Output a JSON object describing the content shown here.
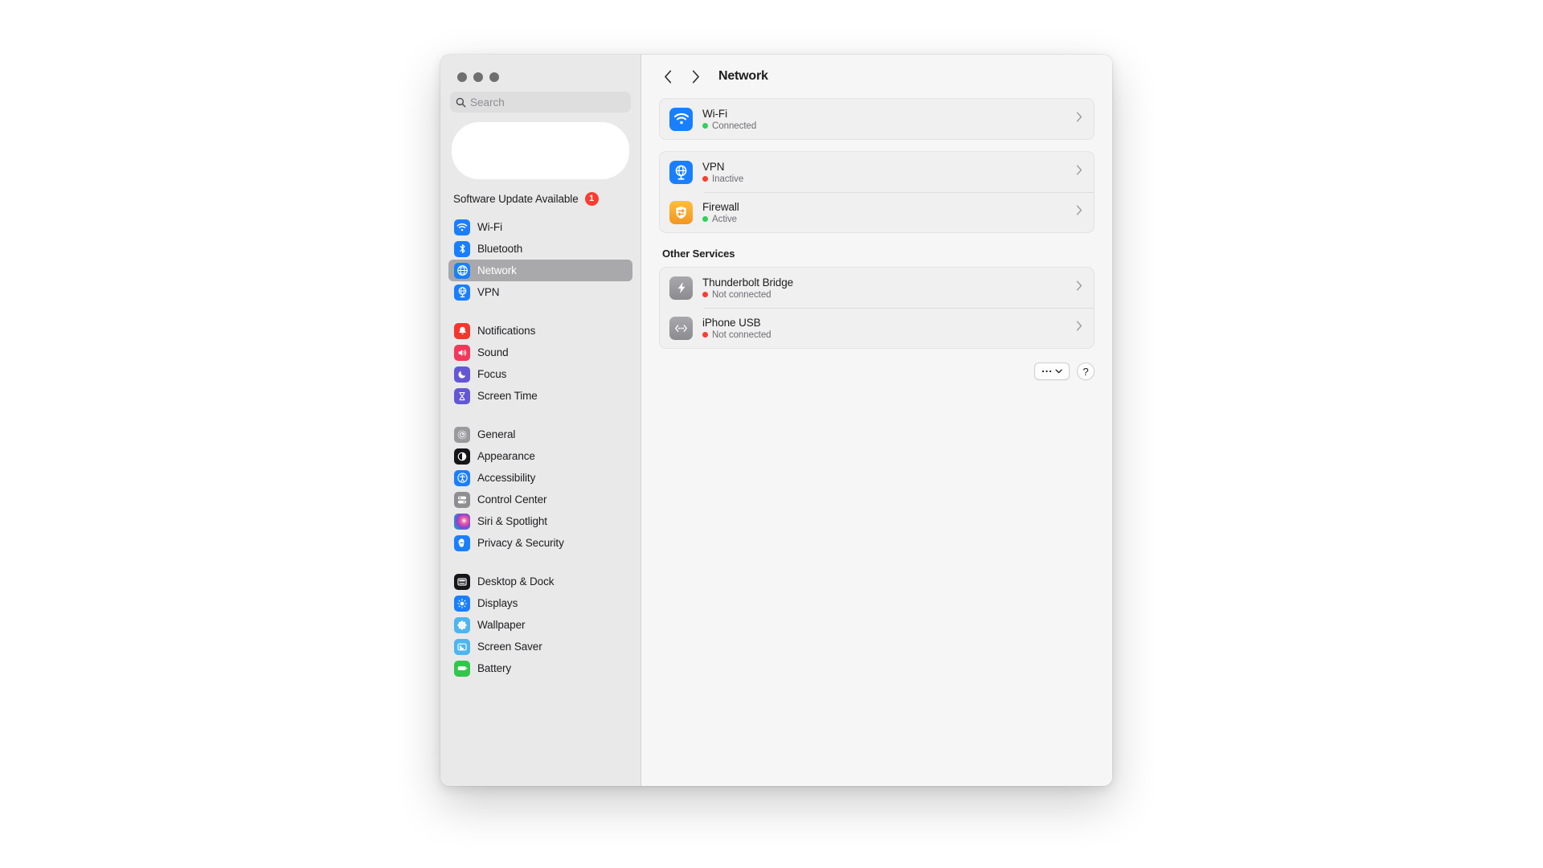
{
  "window": {
    "traffic_lights": [
      "close",
      "minimize",
      "zoom"
    ]
  },
  "sidebar": {
    "search": {
      "placeholder": "Search",
      "value": ""
    },
    "update": {
      "label": "Software Update Available",
      "badge": "1"
    },
    "groups": [
      {
        "items": [
          {
            "label": "Wi-Fi",
            "icon": "wifi-icon",
            "selected": false
          },
          {
            "label": "Bluetooth",
            "icon": "bluetooth-icon",
            "selected": false
          },
          {
            "label": "Network",
            "icon": "network-globe-icon",
            "selected": true
          },
          {
            "label": "VPN",
            "icon": "vpn-globe-icon",
            "selected": false
          }
        ]
      },
      {
        "items": [
          {
            "label": "Notifications",
            "icon": "bell-icon",
            "selected": false
          },
          {
            "label": "Sound",
            "icon": "speaker-icon",
            "selected": false
          },
          {
            "label": "Focus",
            "icon": "moon-icon",
            "selected": false
          },
          {
            "label": "Screen Time",
            "icon": "hourglass-icon",
            "selected": false
          }
        ]
      },
      {
        "items": [
          {
            "label": "General",
            "icon": "gear-icon",
            "selected": false
          },
          {
            "label": "Appearance",
            "icon": "appearance-contrast-icon",
            "selected": false
          },
          {
            "label": "Accessibility",
            "icon": "accessibility-person-icon",
            "selected": false
          },
          {
            "label": "Control Center",
            "icon": "control-center-toggles-icon",
            "selected": false
          },
          {
            "label": "Siri & Spotlight",
            "icon": "siri-orb-icon",
            "selected": false
          },
          {
            "label": "Privacy & Security",
            "icon": "privacy-hand-icon",
            "selected": false
          }
        ]
      },
      {
        "items": [
          {
            "label": "Desktop & Dock",
            "icon": "desktop-dock-icon",
            "selected": false
          },
          {
            "label": "Displays",
            "icon": "displays-sun-icon",
            "selected": false
          },
          {
            "label": "Wallpaper",
            "icon": "wallpaper-flower-icon",
            "selected": false
          },
          {
            "label": "Screen Saver",
            "icon": "screen-saver-icon",
            "selected": false
          },
          {
            "label": "Battery",
            "icon": "battery-icon",
            "selected": false
          }
        ]
      }
    ]
  },
  "content": {
    "title": "Network",
    "back_label": "‹",
    "forward_label": "›",
    "primary_services": [
      {
        "name": "Wi-Fi",
        "status": "Connected",
        "status_color": "#30d158",
        "icon": "wifi-icon"
      }
    ],
    "secondary_services": [
      {
        "name": "VPN",
        "status": "Inactive",
        "status_color": "#ff3b30",
        "icon": "vpn-globe-icon"
      },
      {
        "name": "Firewall",
        "status": "Active",
        "status_color": "#30d158",
        "icon": "firewall-shield-icon"
      }
    ],
    "other_section_title": "Other Services",
    "other_services": [
      {
        "name": "Thunderbolt Bridge",
        "status": "Not connected",
        "status_color": "#ff3b30",
        "icon": "thunderbolt-icon"
      },
      {
        "name": "iPhone USB",
        "status": "Not connected",
        "status_color": "#ff3b30",
        "icon": "iphone-usb-icon"
      }
    ],
    "footer": {
      "more_label": "•••",
      "help_label": "?"
    }
  },
  "colors": {
    "accent_blue": "#0a84ff",
    "sidebar_bg": "#e9e9ea",
    "content_bg": "#f6f6f6",
    "card_bg": "#f0f0f0",
    "selection": "#a9a9ab",
    "badge_red": "#fc3b30"
  }
}
